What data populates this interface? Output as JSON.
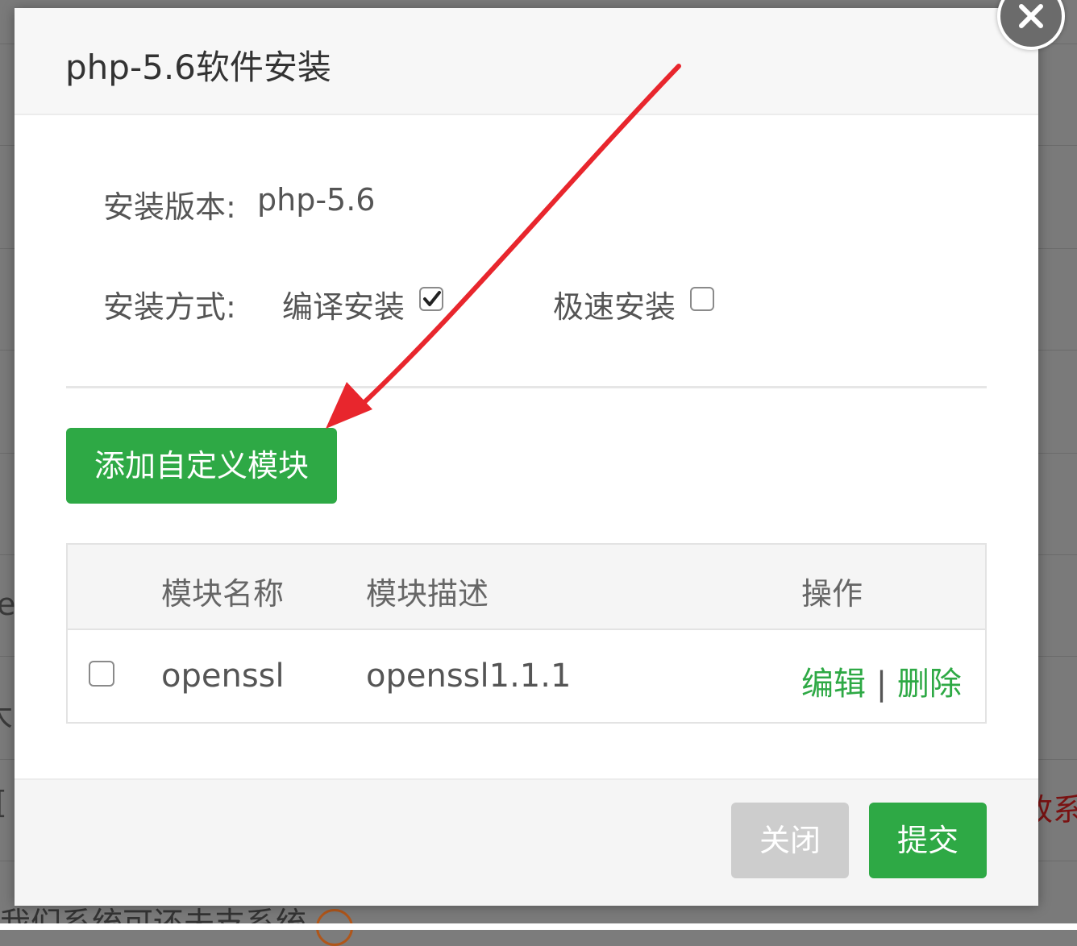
{
  "background": {
    "frag_left_1": "e",
    "frag_left_2": "大",
    "frag_left_3": "[",
    "frag_right": "改系",
    "bottom_text": "我们系统可还未支系统"
  },
  "dialog": {
    "title": "php-5.6软件安装",
    "version_label": "安装版本:",
    "version_value": "php-5.6",
    "method_label": "安装方式:",
    "method_compile": "编译安装",
    "method_compile_checked": true,
    "method_fast": "极速安装",
    "method_fast_checked": false,
    "add_module_button": "添加自定义模块",
    "table": {
      "headers": [
        "模块名称",
        "模块描述",
        "操作"
      ],
      "rows": [
        {
          "checked": false,
          "name": "openssl",
          "description": "openssl1.1.1",
          "edit": "编辑",
          "separator": "|",
          "delete": "删除"
        }
      ]
    },
    "close_button": "关闭",
    "submit_button": "提交"
  },
  "colors": {
    "accent_green": "#2ea945",
    "annotation_arrow": "#e8262d",
    "disabled_button": "#cdcdcd"
  },
  "icons": [
    "close-icon",
    "checkmark-icon"
  ]
}
